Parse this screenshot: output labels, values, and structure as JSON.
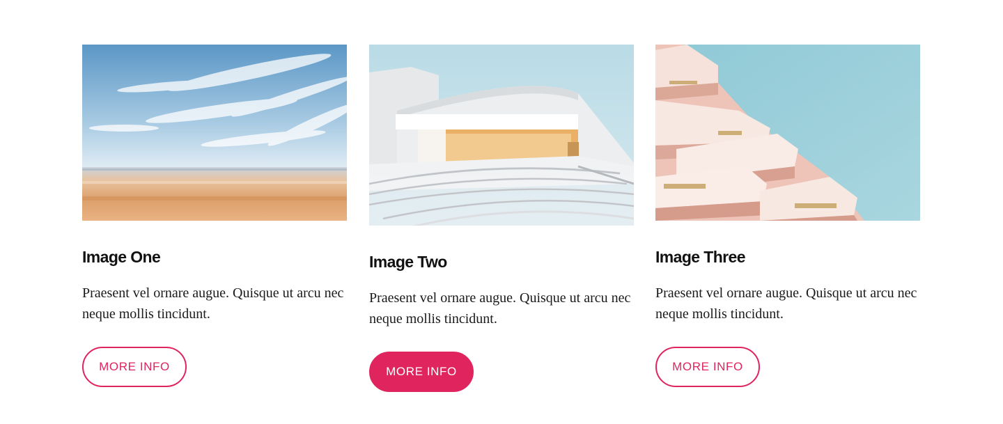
{
  "cards": [
    {
      "title": "Image One",
      "text": "Praesent vel ornare augue. Quisque ut arcu nec neque mollis tincidunt.",
      "button_label": "MORE INFO",
      "button_state": "default"
    },
    {
      "title": "Image Two",
      "text": "Praesent vel ornare augue. Quisque ut arcu nec neque mollis tincidunt.",
      "button_label": "MORE INFO",
      "button_state": "hover"
    },
    {
      "title": "Image Three",
      "text": "Praesent vel ornare augue. Quisque ut arcu nec neque mollis tincidunt.",
      "button_label": "MORE INFO",
      "button_state": "default"
    }
  ],
  "colors": {
    "accent": "#e0245e",
    "text": "#111111",
    "background": "#ffffff"
  }
}
